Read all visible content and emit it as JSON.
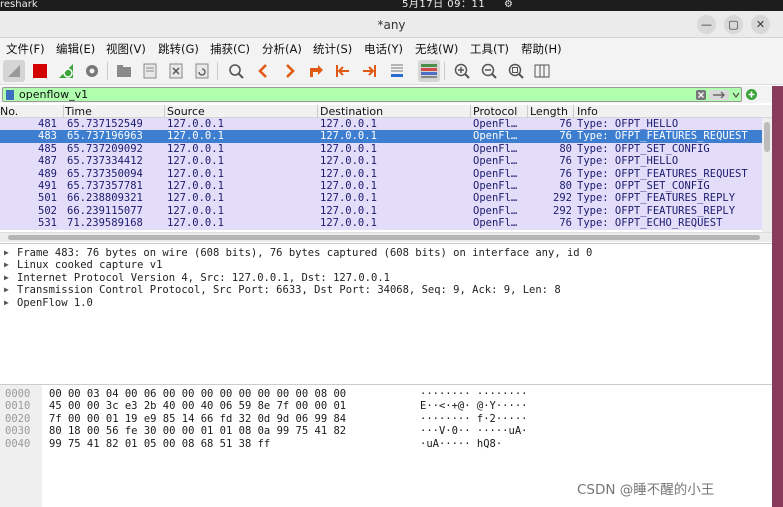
{
  "topbar": {
    "app": "reshark",
    "clock": "5月17日  09：11",
    "status_icon": "⚙"
  },
  "window": {
    "title": "*any"
  },
  "menu": [
    "文件(F)",
    "编辑(E)",
    "视图(V)",
    "跳转(G)",
    "捕获(C)",
    "分析(A)",
    "统计(S)",
    "电话(Y)",
    "无线(W)",
    "工具(T)",
    "帮助(H)"
  ],
  "filter": {
    "value": "openflow_v1"
  },
  "columns": [
    "No.",
    "Time",
    "Source",
    "Destination",
    "Protocol",
    "Length",
    "Info"
  ],
  "packets": [
    {
      "no": "481",
      "time": "65.737152549",
      "src": "127.0.0.1",
      "dst": "127.0.0.1",
      "proto": "OpenFl…",
      "len": "76",
      "info": "Type: OFPT_HELLO",
      "selected": false
    },
    {
      "no": "483",
      "time": "65.737196963",
      "src": "127.0.0.1",
      "dst": "127.0.0.1",
      "proto": "OpenFl…",
      "len": "76",
      "info": "Type: OFPT_FEATURES_REQUEST",
      "selected": true
    },
    {
      "no": "485",
      "time": "65.737209092",
      "src": "127.0.0.1",
      "dst": "127.0.0.1",
      "proto": "OpenFl…",
      "len": "80",
      "info": "Type: OFPT_SET_CONFIG",
      "selected": false
    },
    {
      "no": "487",
      "time": "65.737334412",
      "src": "127.0.0.1",
      "dst": "127.0.0.1",
      "proto": "OpenFl…",
      "len": "76",
      "info": "Type: OFPT_HELLO",
      "selected": false
    },
    {
      "no": "489",
      "time": "65.737350094",
      "src": "127.0.0.1",
      "dst": "127.0.0.1",
      "proto": "OpenFl…",
      "len": "76",
      "info": "Type: OFPT_FEATURES_REQUEST",
      "selected": false
    },
    {
      "no": "491",
      "time": "65.737357781",
      "src": "127.0.0.1",
      "dst": "127.0.0.1",
      "proto": "OpenFl…",
      "len": "80",
      "info": "Type: OFPT_SET_CONFIG",
      "selected": false
    },
    {
      "no": "501",
      "time": "66.238809321",
      "src": "127.0.0.1",
      "dst": "127.0.0.1",
      "proto": "OpenFl…",
      "len": "292",
      "info": "Type: OFPT_FEATURES_REPLY",
      "selected": false
    },
    {
      "no": "502",
      "time": "66.239115077",
      "src": "127.0.0.1",
      "dst": "127.0.0.1",
      "proto": "OpenFl…",
      "len": "292",
      "info": "Type: OFPT_FEATURES_REPLY",
      "selected": false
    },
    {
      "no": "531",
      "time": "71.239589168",
      "src": "127.0.0.1",
      "dst": "127.0.0.1",
      "proto": "OpenFl…",
      "len": "76",
      "info": "Type: OFPT_ECHO_REQUEST",
      "selected": false
    }
  ],
  "details": [
    "Frame 483: 76 bytes on wire (608 bits), 76 bytes captured (608 bits) on interface any, id 0",
    "Linux cooked capture v1",
    "Internet Protocol Version 4, Src: 127.0.0.1, Dst: 127.0.0.1",
    "Transmission Control Protocol, Src Port: 6633, Dst Port: 34068, Seq: 9, Ack: 9, Len: 8",
    "OpenFlow 1.0"
  ],
  "bytes": [
    {
      "offset": "0000",
      "hex": "00 00 03 04 00 06 00 00   00 00 00 00 00 00 08 00",
      "ascii": "········ ········"
    },
    {
      "offset": "0010",
      "hex": "45 00 00 3c e3 2b 40 00   40 06 59 8e 7f 00 00 01",
      "ascii": "E··<·+@· @·Y·····"
    },
    {
      "offset": "0020",
      "hex": "7f 00 00 01 19 e9 85 14   66 fd 32 0d 9d 06 99 84",
      "ascii": "········ f·2·····"
    },
    {
      "offset": "0030",
      "hex": "80 18 00 56 fe 30 00 00   01 01 08 0a 99 75 41 82",
      "ascii": "···V·0·· ·····uA·"
    },
    {
      "offset": "0040",
      "hex": "99 75 41 82 01 05 00 08   68 51 38 ff",
      "ascii": "·uA····· hQ8·"
    }
  ],
  "watermark": "CSDN @睡不醒的小王",
  "colors": {
    "selected_row": "#3d7ed1",
    "row_bg": "#e4ddfa",
    "filter_ok": "#afffaf"
  }
}
